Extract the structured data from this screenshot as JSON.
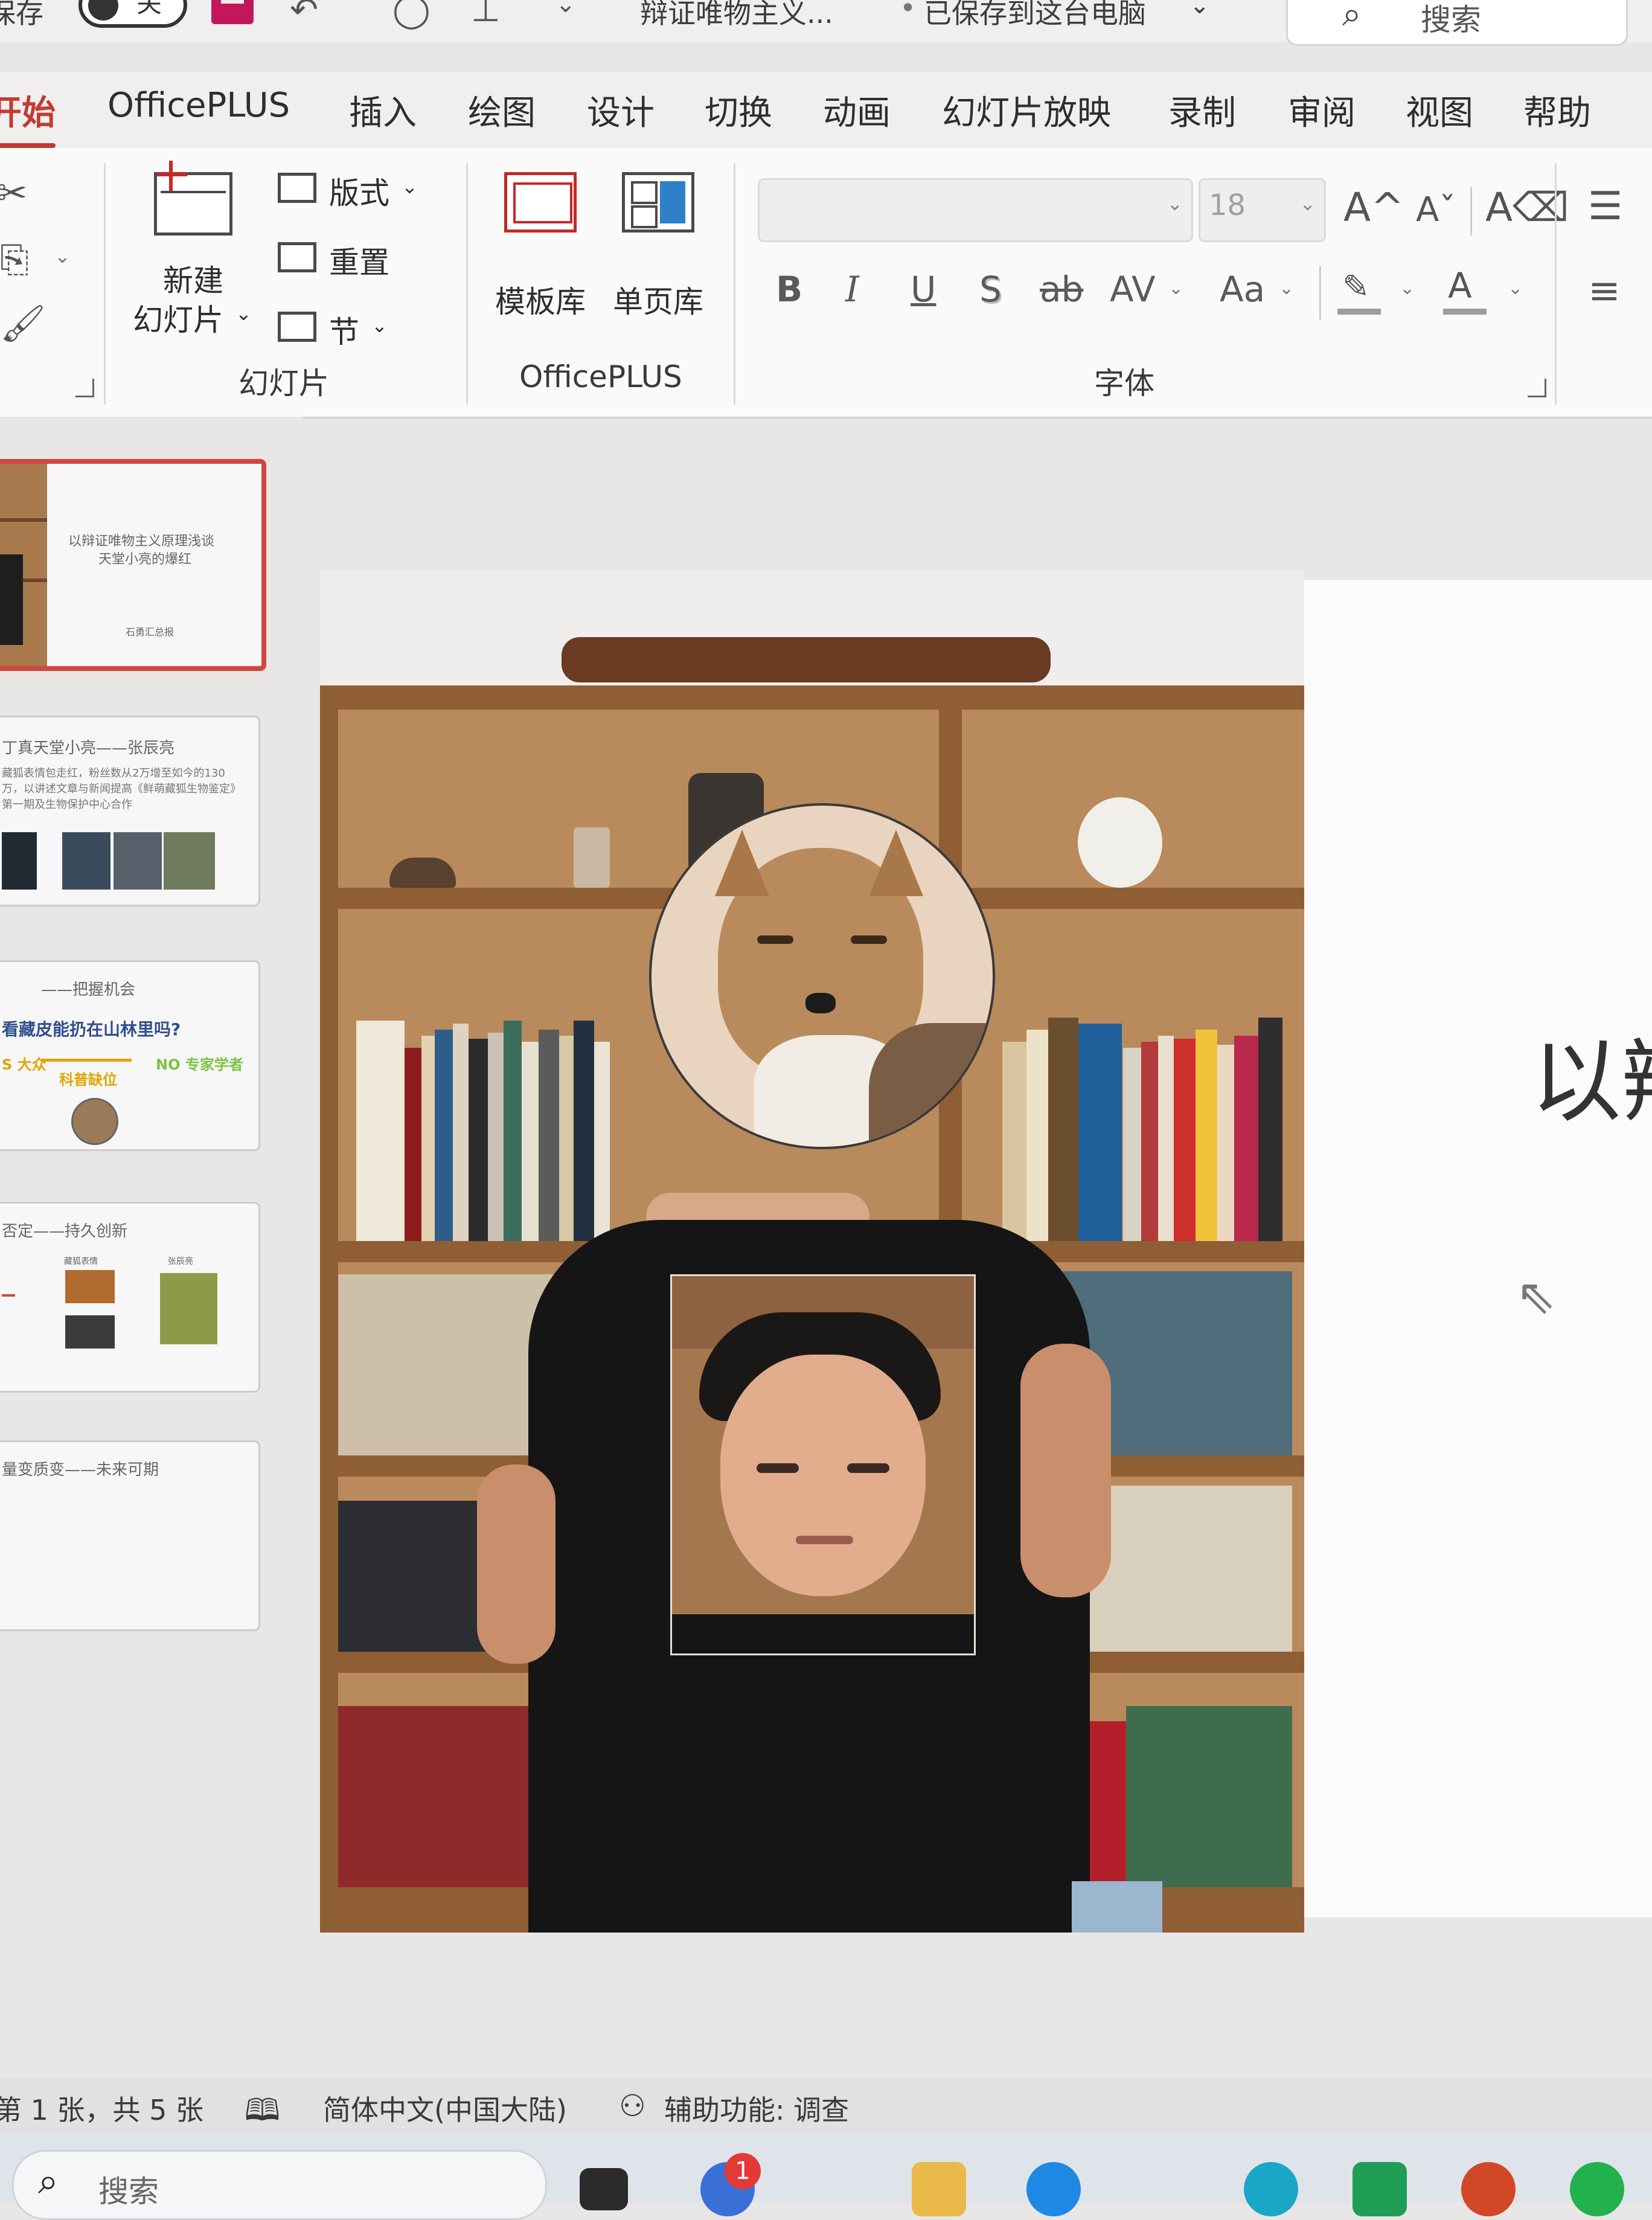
{
  "titlebar": {
    "autosave_label": "保存",
    "autosave_state": "关",
    "document_name": "辩证唯物主义...",
    "save_status": "已保存到这台电脑",
    "search_placeholder": "搜索"
  },
  "ribbon_tabs": [
    {
      "label": "开始",
      "active": true
    },
    {
      "label": "OfficePLUS"
    },
    {
      "label": "插入"
    },
    {
      "label": "绘图"
    },
    {
      "label": "设计"
    },
    {
      "label": "切换"
    },
    {
      "label": "动画"
    },
    {
      "label": "幻灯片放映"
    },
    {
      "label": "录制"
    },
    {
      "label": "审阅"
    },
    {
      "label": "视图"
    },
    {
      "label": "帮助"
    }
  ],
  "ribbon": {
    "slides_group": {
      "label": "幻灯片",
      "new_slide_line1": "新建",
      "new_slide_line2": "幻灯片",
      "layout": "版式",
      "reset": "重置",
      "section": "节"
    },
    "officeplus_group": {
      "label": "OfficePLUS",
      "template_library": "模板库",
      "single_page_library": "单页库"
    },
    "font_group": {
      "label": "字体",
      "font_size": "18",
      "bold": "B",
      "italic": "I",
      "underline": "U",
      "shadow": "S",
      "strikethrough": "ab",
      "char_spacing": "AV",
      "change_case": "Aa",
      "grow": "A^",
      "shrink": "Aˇ",
      "font_color": "A"
    }
  },
  "slides": [
    {
      "number": 1,
      "title": "以辩证唯物主义原理浅谈",
      "subtitle": "天堂小亮的爆红",
      "footer": "石勇汇总报",
      "selected": true
    },
    {
      "number": 2,
      "title": "丁真天堂小亮——张辰亮",
      "body": "藏狐表情包走红，粉丝数从2万增至如今的130万，以讲述文章与新闻提高《鲜萌藏狐生物鉴定》第一期及生物保护中心合作"
    },
    {
      "number": 3,
      "title": "——把握机会",
      "question": "看藏皮能扔在山林里吗?",
      "left_tag": "S 大众",
      "mid_tag": "科普缺位",
      "right_tag": "NO 专家学者"
    },
    {
      "number": 4,
      "title": "否定——持久创新",
      "col1_label": "藏狐表情",
      "col2_label": "张辰亮"
    },
    {
      "number": 5,
      "title": "量变质变——未来可期"
    }
  ],
  "slide_canvas": {
    "title_partial": "以辨"
  },
  "statusbar": {
    "slide_position": "第 1 张，共 5 张",
    "language": "简体中文(中国大陆)",
    "accessibility": "辅助功能: 调查"
  },
  "taskbar": {
    "search_placeholder": "搜索",
    "notification_count": "1"
  },
  "colors": {
    "accent": "#c23b32",
    "ribbon_bg": "#fbfafa",
    "panel_bg": "#e9e6e6"
  }
}
